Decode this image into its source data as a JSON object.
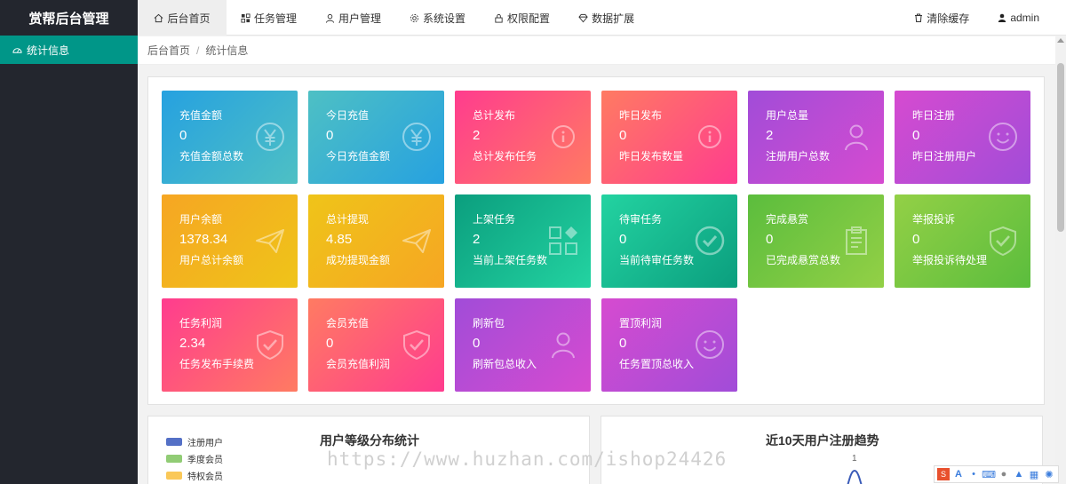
{
  "app": {
    "title": "赏帮后台管理"
  },
  "top_nav": [
    {
      "label": "后台首页",
      "icon": "home-icon",
      "active": true
    },
    {
      "label": "任务管理",
      "icon": "task-icon"
    },
    {
      "label": "用户管理",
      "icon": "user-icon"
    },
    {
      "label": "系统设置",
      "icon": "gear-icon"
    },
    {
      "label": "权限配置",
      "icon": "lock-icon"
    },
    {
      "label": "数据扩展",
      "icon": "diamond-icon"
    }
  ],
  "top_right": {
    "clear_cache": "清除缓存",
    "user": "admin"
  },
  "sidebar": {
    "items": [
      {
        "label": "统计信息",
        "icon": "dashboard-icon",
        "active": true
      }
    ]
  },
  "breadcrumb": {
    "home": "后台首页",
    "sep": "/",
    "current": "统计信息"
  },
  "cards": [
    {
      "title": "充值金额",
      "value": "0",
      "desc": "充值金额总数",
      "icon": "yen-icon",
      "from": "#26a1e0",
      "to": "#4ec0c4"
    },
    {
      "title": "今日充值",
      "value": "0",
      "desc": "今日充值金额",
      "icon": "yen-icon",
      "from": "#4ec0c4",
      "to": "#26a1e0"
    },
    {
      "title": "总计发布",
      "value": "2",
      "desc": "总计发布任务",
      "icon": "info-icon",
      "from": "#ff3c8e",
      "to": "#ff7b62"
    },
    {
      "title": "昨日发布",
      "value": "0",
      "desc": "昨日发布数量",
      "icon": "info-icon",
      "from": "#ff7b62",
      "to": "#ff3c8e"
    },
    {
      "title": "用户总量",
      "value": "2",
      "desc": "注册用户总数",
      "icon": "person-icon",
      "from": "#a14cd8",
      "to": "#d64bd0"
    },
    {
      "title": "昨日注册",
      "value": "0",
      "desc": "昨日注册用户",
      "icon": "smile-icon",
      "from": "#d64bd0",
      "to": "#a14cd8"
    },
    {
      "title": "用户余额",
      "value": "1378.34",
      "desc": "用户总计余额",
      "icon": "send-icon",
      "from": "#f6a623",
      "to": "#efc419"
    },
    {
      "title": "总计提现",
      "value": "4.85",
      "desc": "成功提现金额",
      "icon": "send-icon",
      "from": "#efc419",
      "to": "#f6a623"
    },
    {
      "title": "上架任务",
      "value": "2",
      "desc": "当前上架任务数",
      "icon": "apps-icon",
      "from": "#0b9e7e",
      "to": "#23d3a1"
    },
    {
      "title": "待审任务",
      "value": "0",
      "desc": "当前待审任务数",
      "icon": "check-circle-icon",
      "from": "#23d3a1",
      "to": "#0b9e7e"
    },
    {
      "title": "完成悬赏",
      "value": "0",
      "desc": "已完成悬赏总数",
      "icon": "clipboard-icon",
      "from": "#5bbd3d",
      "to": "#93d046"
    },
    {
      "title": "举报投诉",
      "value": "0",
      "desc": "举报投诉待处理",
      "icon": "shield-check-icon",
      "from": "#93d046",
      "to": "#5bbd3d"
    },
    {
      "title": "任务利润",
      "value": "2.34",
      "desc": "任务发布手续费",
      "icon": "shield-check-icon",
      "from": "#ff3c8e",
      "to": "#ff7b62"
    },
    {
      "title": "会员充值",
      "value": "0",
      "desc": "会员充值利润",
      "icon": "shield-check-icon",
      "from": "#ff7b62",
      "to": "#ff3c8e"
    },
    {
      "title": "刷新包",
      "value": "0",
      "desc": "刷新包总收入",
      "icon": "person-icon",
      "from": "#a14cd8",
      "to": "#d64bd0"
    },
    {
      "title": "置顶利润",
      "value": "0",
      "desc": "任务置顶总收入",
      "icon": "smile-icon",
      "from": "#d64bd0",
      "to": "#a14cd8"
    }
  ],
  "charts": {
    "level": {
      "title": "用户等级分布统计",
      "legend": [
        {
          "label": "注册用户",
          "color": "#5470c6"
        },
        {
          "label": "季度会员",
          "color": "#91cc75"
        },
        {
          "label": "特权会员",
          "color": "#fac858"
        },
        {
          "label": "",
          "color": "#ee6666"
        }
      ]
    },
    "trend": {
      "title": "近10天用户注册趋势",
      "y_tick": "1"
    }
  },
  "watermark": "https://www.huzhan.com/ishop24426"
}
